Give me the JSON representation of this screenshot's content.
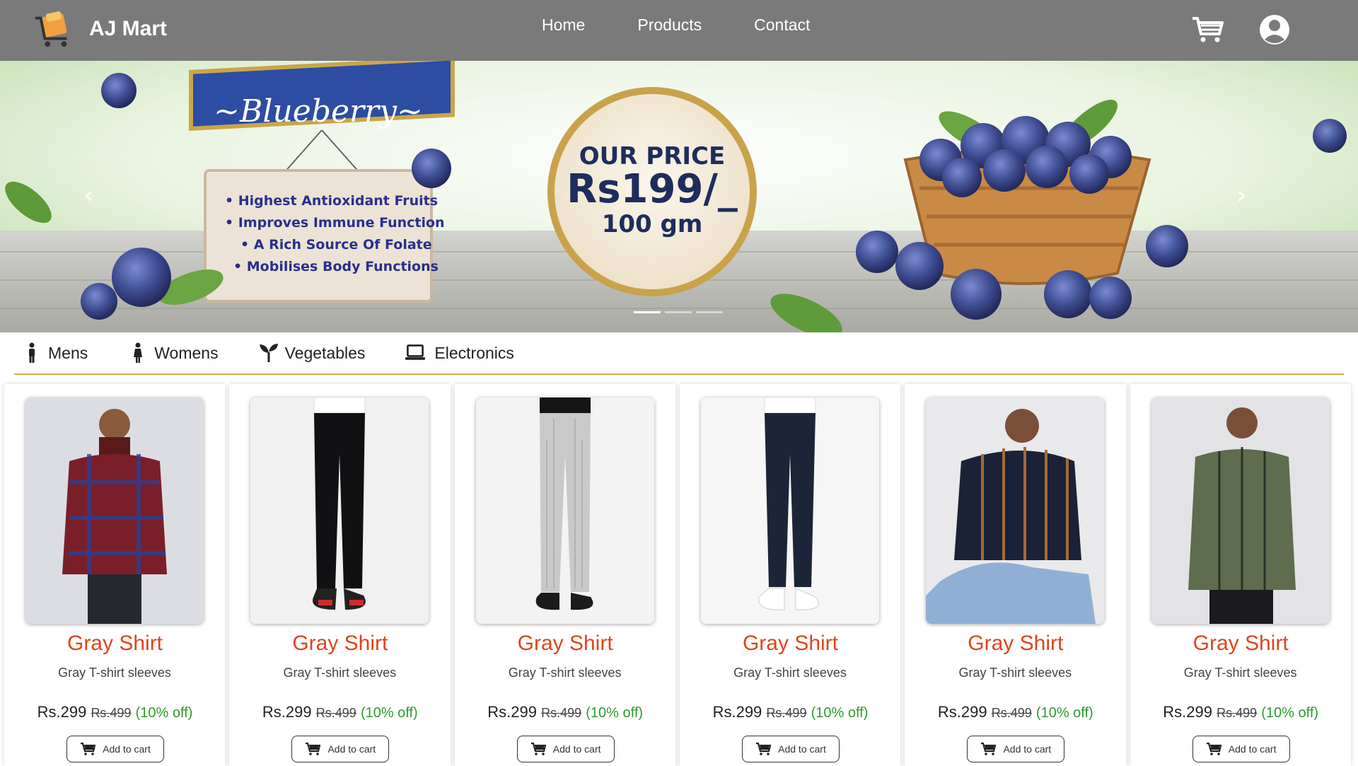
{
  "brand": {
    "name": "AJ Mart",
    "logo_icon": "shopping-cart-logo-icon"
  },
  "nav": {
    "links": [
      "Home",
      "Products",
      "Contact"
    ],
    "cart_icon": "cart-icon",
    "user_icon": "user-circle-icon"
  },
  "hero": {
    "sign_title": "~Blueberry~",
    "bullets": [
      "Highest Antioxidant Fruits",
      "Improves Immune Function",
      "A Rich Source Of Folate",
      "Mobilises Body Functions"
    ],
    "badge_line1": "OUR PRICE",
    "badge_price": "Rs199/_",
    "badge_line3": "100 gm",
    "prev_glyph": "‹",
    "next_glyph": "›",
    "slides": 3,
    "active_slide": 1
  },
  "categories": [
    {
      "label": "Mens",
      "icon": "male-icon"
    },
    {
      "label": "Womens",
      "icon": "female-icon"
    },
    {
      "label": "Vegetables",
      "icon": "seedling-icon"
    },
    {
      "label": "Electronics",
      "icon": "laptop-icon"
    }
  ],
  "products": [
    {
      "title": "Gray Shirt",
      "desc": "Gray T-shirt sleeves",
      "price": "Rs.299",
      "old_price": "Rs.499",
      "discount": "(10% off)",
      "button": "Add to cart"
    },
    {
      "title": "Gray Shirt",
      "desc": "Gray T-shirt sleeves",
      "price": "Rs.299",
      "old_price": "Rs.499",
      "discount": "(10% off)",
      "button": "Add to cart"
    },
    {
      "title": "Gray Shirt",
      "desc": "Gray T-shirt sleeves",
      "price": "Rs.299",
      "old_price": "Rs.499",
      "discount": "(10% off)",
      "button": "Add to cart"
    },
    {
      "title": "Gray Shirt",
      "desc": "Gray T-shirt sleeves",
      "price": "Rs.299",
      "old_price": "Rs.499",
      "discount": "(10% off)",
      "button": "Add to cart"
    },
    {
      "title": "Gray Shirt",
      "desc": "Gray T-shirt sleeves",
      "price": "Rs.299",
      "old_price": "Rs.499",
      "discount": "(10% off)",
      "button": "Add to cart"
    },
    {
      "title": "Gray Shirt",
      "desc": "Gray T-shirt sleeves",
      "price": "Rs.299",
      "old_price": "Rs.499",
      "discount": "(10% off)",
      "button": "Add to cart"
    }
  ],
  "colors": {
    "navbar": "#7a7a7a",
    "title_red": "#e0441c",
    "discount_green": "#2f9a2f",
    "category_underline": "#e3a64a"
  }
}
